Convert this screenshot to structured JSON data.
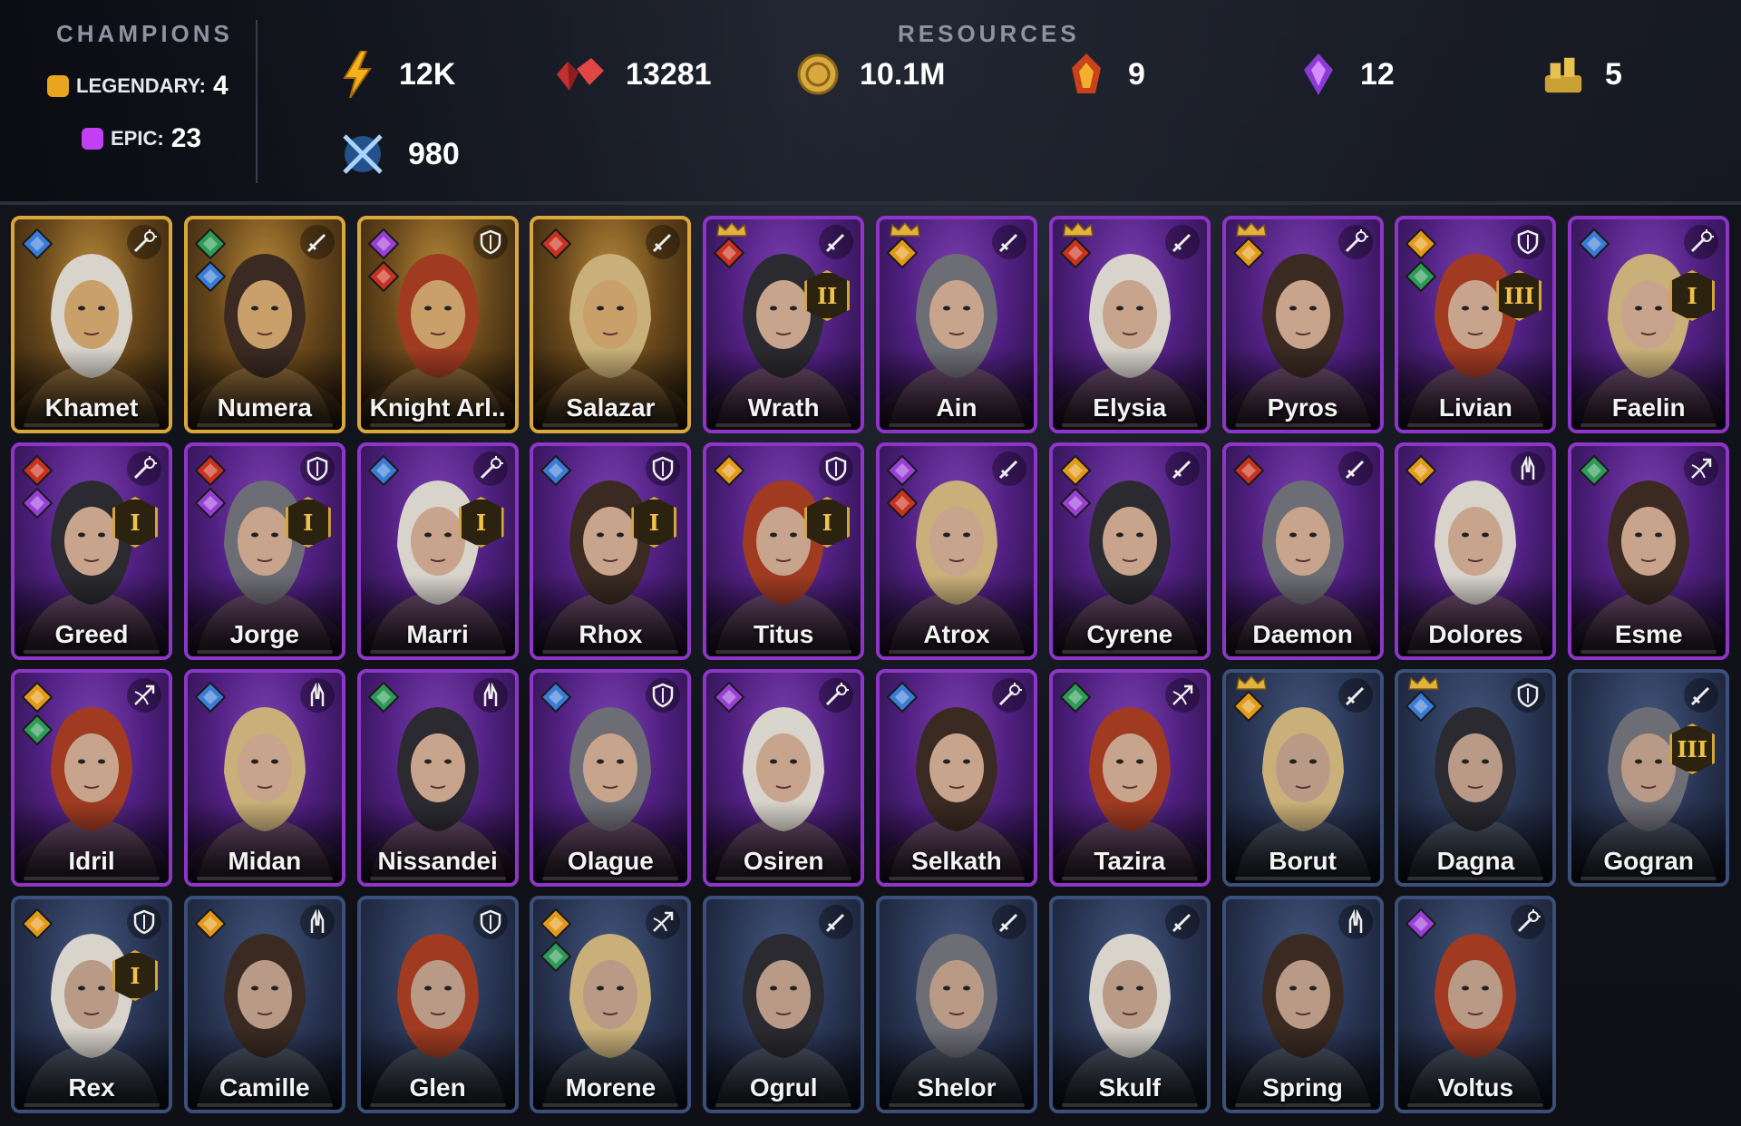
{
  "header": {
    "champions_title": "CHAMPIONS",
    "resources_title": "RESOURCES",
    "legendary_label": "LEGENDARY:",
    "legendary_count": "4",
    "epic_label": "EPIC:",
    "epic_count": "23",
    "colors": {
      "legendary": "#e8a51d",
      "epic": "#c23ff2"
    }
  },
  "resources": [
    {
      "icon": "energy-bolt-icon",
      "value": "12K"
    },
    {
      "icon": "ruby-gems-icon",
      "value": "13281"
    },
    {
      "icon": "gold-coin-icon",
      "value": "10.1M"
    },
    {
      "icon": "fire-emblem-icon",
      "value": "9"
    },
    {
      "icon": "void-crystal-icon",
      "value": "12"
    },
    {
      "icon": "gold-pile-icon",
      "value": "5"
    },
    {
      "icon": "crossed-swords-icon",
      "value": "980"
    }
  ],
  "champions": [
    {
      "name": "Khamet",
      "rarity": "legendary",
      "role": "magic",
      "aff": [
        "blue"
      ],
      "ascend": ""
    },
    {
      "name": "Numera",
      "rarity": "legendary",
      "role": "sword",
      "aff": [
        "green",
        "blue"
      ],
      "ascend": ""
    },
    {
      "name": "Knight Arl..",
      "rarity": "legendary",
      "role": "shield",
      "aff": [
        "purple",
        "red"
      ],
      "ascend": ""
    },
    {
      "name": "Salazar",
      "rarity": "legendary",
      "role": "sword",
      "aff": [
        "red"
      ],
      "ascend": ""
    },
    {
      "name": "Wrath",
      "rarity": "epic",
      "role": "sword",
      "aff": [
        "red"
      ],
      "crown": true,
      "ascend": "II"
    },
    {
      "name": "Ain",
      "rarity": "epic",
      "role": "sword",
      "aff": [
        "orange"
      ],
      "crown": true,
      "ascend": ""
    },
    {
      "name": "Elysia",
      "rarity": "epic",
      "role": "sword",
      "aff": [
        "red"
      ],
      "crown": true,
      "ascend": ""
    },
    {
      "name": "Pyros",
      "rarity": "epic",
      "role": "magic",
      "aff": [
        "orange"
      ],
      "crown": true,
      "ascend": ""
    },
    {
      "name": "Livian",
      "rarity": "epic",
      "role": "shield",
      "aff": [
        "orange",
        "green"
      ],
      "ascend": "III"
    },
    {
      "name": "Faelin",
      "rarity": "epic",
      "role": "magic",
      "aff": [
        "blue"
      ],
      "ascend": "I"
    },
    {
      "name": "Greed",
      "rarity": "epic",
      "role": "magic",
      "aff": [
        "red",
        "purple"
      ],
      "ascend": "I"
    },
    {
      "name": "Jorge",
      "rarity": "epic",
      "role": "shield",
      "aff": [
        "red",
        "purple"
      ],
      "ascend": "I"
    },
    {
      "name": "Marri",
      "rarity": "epic",
      "role": "magic",
      "aff": [
        "blue"
      ],
      "ascend": "I"
    },
    {
      "name": "Rhox",
      "rarity": "epic",
      "role": "shield",
      "aff": [
        "blue"
      ],
      "ascend": "I"
    },
    {
      "name": "Titus",
      "rarity": "epic",
      "role": "shield",
      "aff": [
        "orange"
      ],
      "ascend": "I"
    },
    {
      "name": "Atrox",
      "rarity": "epic",
      "role": "sword",
      "aff": [
        "purple",
        "red"
      ],
      "ascend": ""
    },
    {
      "name": "Cyrene",
      "rarity": "epic",
      "role": "sword",
      "aff": [
        "orange",
        "purple"
      ],
      "ascend": ""
    },
    {
      "name": "Daemon",
      "rarity": "epic",
      "role": "sword",
      "aff": [
        "red"
      ],
      "ascend": ""
    },
    {
      "name": "Dolores",
      "rarity": "epic",
      "role": "support",
      "aff": [
        "orange"
      ],
      "ascend": ""
    },
    {
      "name": "Esme",
      "rarity": "epic",
      "role": "bow",
      "aff": [
        "green"
      ],
      "ascend": ""
    },
    {
      "name": "Idril",
      "rarity": "epic",
      "role": "bow",
      "aff": [
        "orange",
        "green"
      ],
      "ascend": ""
    },
    {
      "name": "Midan",
      "rarity": "epic",
      "role": "support",
      "aff": [
        "blue"
      ],
      "ascend": ""
    },
    {
      "name": "Nissandei",
      "rarity": "epic",
      "role": "support",
      "aff": [
        "green"
      ],
      "ascend": ""
    },
    {
      "name": "Olague",
      "rarity": "epic",
      "role": "shield",
      "aff": [
        "blue"
      ],
      "ascend": ""
    },
    {
      "name": "Osiren",
      "rarity": "epic",
      "role": "magic",
      "aff": [
        "purple"
      ],
      "ascend": ""
    },
    {
      "name": "Selkath",
      "rarity": "epic",
      "role": "magic",
      "aff": [
        "blue"
      ],
      "ascend": ""
    },
    {
      "name": "Tazira",
      "rarity": "epic",
      "role": "bow",
      "aff": [
        "green"
      ],
      "ascend": ""
    },
    {
      "name": "Borut",
      "rarity": "rare",
      "role": "sword",
      "aff": [
        "orange"
      ],
      "crown": true,
      "ascend": ""
    },
    {
      "name": "Dagna",
      "rarity": "rare",
      "role": "shield",
      "aff": [
        "blue"
      ],
      "crown": true,
      "ascend": ""
    },
    {
      "name": "Gogran",
      "rarity": "rare",
      "role": "sword",
      "aff": [],
      "ascend": "III"
    },
    {
      "name": "Rex",
      "rarity": "rare",
      "role": "shield",
      "aff": [
        "orange"
      ],
      "ascend": "I"
    },
    {
      "name": "Camille",
      "rarity": "rare",
      "role": "support",
      "aff": [
        "orange"
      ],
      "ascend": ""
    },
    {
      "name": "Glen",
      "rarity": "rare",
      "role": "shield",
      "aff": [],
      "ascend": ""
    },
    {
      "name": "Morene",
      "rarity": "rare",
      "role": "bow",
      "aff": [
        "orange",
        "green"
      ],
      "ascend": ""
    },
    {
      "name": "Ogrul",
      "rarity": "rare",
      "role": "sword",
      "aff": [],
      "ascend": ""
    },
    {
      "name": "Shelor",
      "rarity": "rare",
      "role": "sword",
      "aff": [],
      "ascend": ""
    },
    {
      "name": "Skulf",
      "rarity": "rare",
      "role": "sword",
      "aff": [],
      "ascend": ""
    },
    {
      "name": "Spring",
      "rarity": "rare",
      "role": "support",
      "aff": [],
      "ascend": ""
    },
    {
      "name": "Voltus",
      "rarity": "rare",
      "role": "magic",
      "aff": [
        "purple"
      ],
      "ascend": ""
    }
  ]
}
